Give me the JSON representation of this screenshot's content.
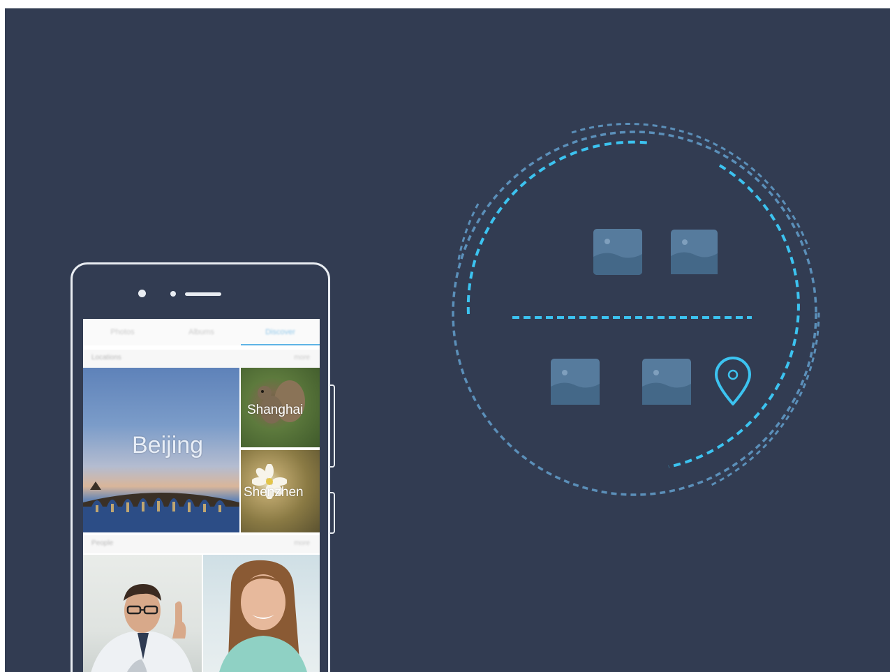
{
  "gallery": {
    "tabs": [
      "Photos",
      "Albums",
      "Discover"
    ],
    "active_tab": "Discover",
    "locations_section": {
      "title": "Locations",
      "more": "more"
    },
    "people_section": {
      "title": "People",
      "more": "more"
    },
    "locations": {
      "beijing": "Beijing",
      "shanghai": "Shanghai",
      "shenzhen": "Shenzhen"
    }
  },
  "illustration": {
    "icons": [
      "image-icon",
      "image-icon",
      "image-icon",
      "image-icon",
      "location-pin-icon"
    ],
    "colors": {
      "background": "#323c52",
      "accent": "#3cc3f0",
      "muted_dash": "#5b8fb9",
      "tile": "#4f6f91"
    }
  }
}
